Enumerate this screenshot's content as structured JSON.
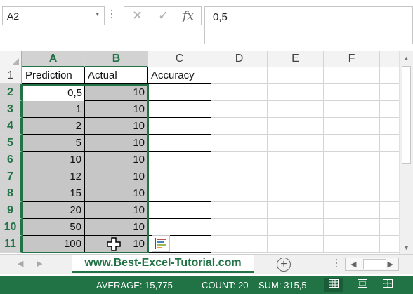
{
  "formula_bar": {
    "name_box": "A2",
    "name_box_arrow": "▾",
    "cancel_glyph": "✕",
    "enter_glyph": "✓",
    "fx_glyph": "fx",
    "formula_value": "0,5"
  },
  "columns": [
    "A",
    "B",
    "C",
    "D",
    "E",
    "F"
  ],
  "rows": [
    "1",
    "2",
    "3",
    "4",
    "5",
    "6",
    "7",
    "8",
    "9",
    "10",
    "11"
  ],
  "table": {
    "headers": {
      "a": "Prediction",
      "b": "Actual",
      "c": "Accuracy"
    },
    "prediction": [
      "0,5",
      "1",
      "2",
      "5",
      "10",
      "12",
      "15",
      "20",
      "50",
      "100"
    ],
    "actual": [
      "10",
      "10",
      "10",
      "10",
      "10",
      "10",
      "10",
      "10",
      "10",
      "10"
    ]
  },
  "sheet_tab": {
    "label": "www.Best-Excel-Tutorial.com",
    "add_glyph": "+"
  },
  "status_bar": {
    "average": "AVERAGE: 15,775",
    "count": "COUNT: 20",
    "sum": "SUM: 315,5"
  },
  "icons": {
    "cursor": "plus-cursor-icon",
    "quick_analysis": "quick-analysis-icon",
    "normal_view": "normal-view-icon",
    "page_layout": "page-layout-view-icon",
    "page_break": "page-break-preview-icon"
  },
  "colors": {
    "accent": "#217346",
    "selection": "#c6c6c6"
  }
}
